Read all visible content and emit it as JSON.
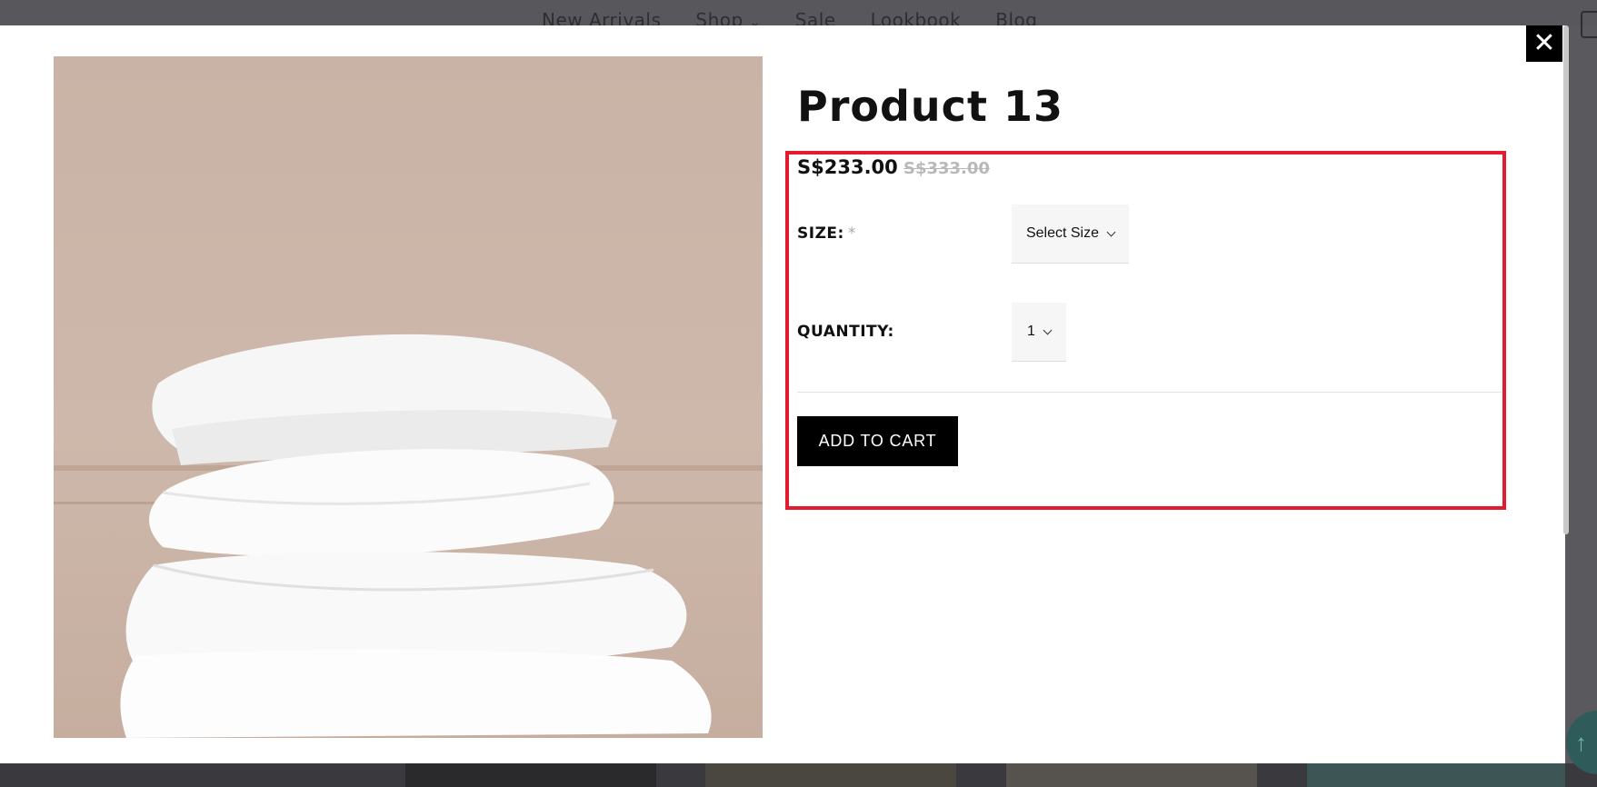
{
  "background_nav": {
    "items": [
      "New Arrivals",
      "Shop",
      "Sale",
      "Lookbook",
      "Blog"
    ]
  },
  "modal": {
    "close_icon": "close-icon",
    "product": {
      "title": "Product 13",
      "price": "S$233.00",
      "compare_price": "S$333.00",
      "size_label": "SIZE:",
      "size_required_mark": "*",
      "size_value": "Select Size",
      "quantity_label": "QUANTITY:",
      "quantity_value": "1",
      "add_to_cart_label": "ADD TO CART"
    },
    "highlight_color": "#e31b2e"
  },
  "scroll_top_icon": "arrow-up-icon"
}
